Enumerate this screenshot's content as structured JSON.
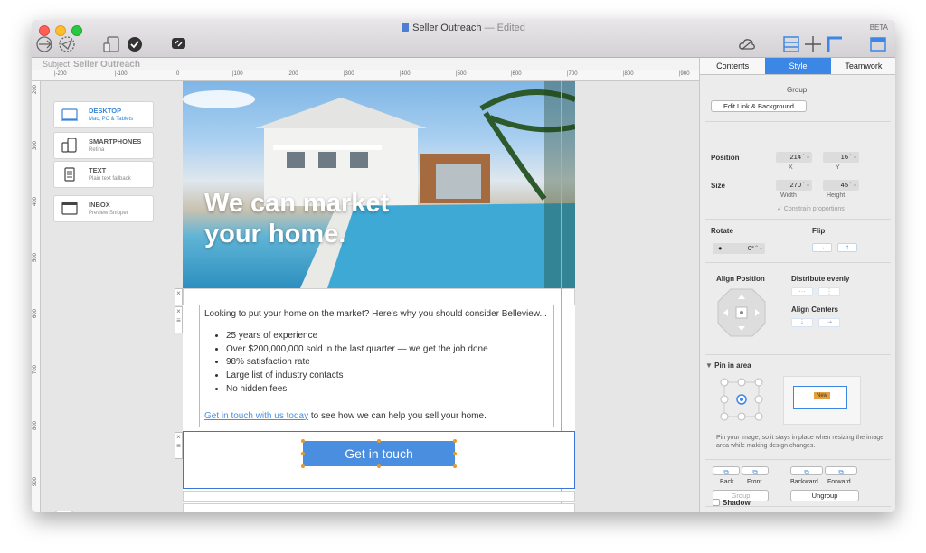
{
  "window": {
    "title": "Seller Outreach",
    "edited": "— Edited",
    "beta": "BETA"
  },
  "toolbar_icons": [
    "preview-icon",
    "send-test-icon",
    "devices-icon",
    "check-icon",
    "chat-icon",
    "cloud-icon",
    "layout-icon",
    "move-icon",
    "frame-icon",
    "sidebar-icon"
  ],
  "subject": {
    "label": "Subject",
    "value": "Seller Outreach"
  },
  "ruler_top": [
    "|-200",
    "|-100",
    "0",
    "|100",
    "|200",
    "|300",
    "|400",
    "|500",
    "|600",
    "|700",
    "|800",
    "|900"
  ],
  "ruler_left": [
    "200",
    "300",
    "400",
    "500",
    "600",
    "700",
    "800",
    "900"
  ],
  "devices": [
    {
      "name": "DESKTOP",
      "sub": "Mac, PC & Tablets",
      "active": true
    },
    {
      "name": "SMARTPHONES",
      "sub": "Retina",
      "active": false
    },
    {
      "name": "TEXT",
      "sub": "Plain text fallback",
      "active": false
    },
    {
      "name": "INBOX",
      "sub": "Preview Snippet",
      "active": false
    }
  ],
  "email": {
    "hero_heading_1": "We can market",
    "hero_heading_2": "your home.",
    "intro": "Looking to put your home on the market? Here's why you should consider Belleview...",
    "bullets": [
      "25 years of experience",
      "Over $200,000,000 sold in the last quarter — we get the job done",
      "98% satisfaction rate",
      "Large list of industry contacts",
      "No hidden fees"
    ],
    "cta_link": "Get in touch with us today",
    "cta_rest": " to see how we can help you sell your home.",
    "button": "Get in touch"
  },
  "inspector": {
    "tabs": [
      "Contents",
      "Style",
      "Teamwork"
    ],
    "group_title": "Group",
    "edit_link_bg": "Edit Link & Background",
    "position_label": "Position",
    "x": "214",
    "y": "16",
    "x_label": "X",
    "y_label": "Y",
    "size_label": "Size",
    "width": "270",
    "height": "45",
    "width_label": "Width",
    "height_label": "Height",
    "constrain": "✓ Constrain proportions",
    "rotate_label": "Rotate",
    "rotate_value": "0°",
    "flip_label": "Flip",
    "align_position": "Align Position",
    "distribute_evenly": "Distribute evenly",
    "align_centers": "Align Centers",
    "pin_label": "Pin in area",
    "pin_new": "New",
    "pin_desc": "Pin your image, so it stays in place when resizing the image area while making design changes.",
    "back": "Back",
    "front": "Front",
    "backward": "Backward",
    "forward": "Forward",
    "group_btn": "Group",
    "ungroup_btn": "Ungroup",
    "shadow": "Shadow"
  }
}
